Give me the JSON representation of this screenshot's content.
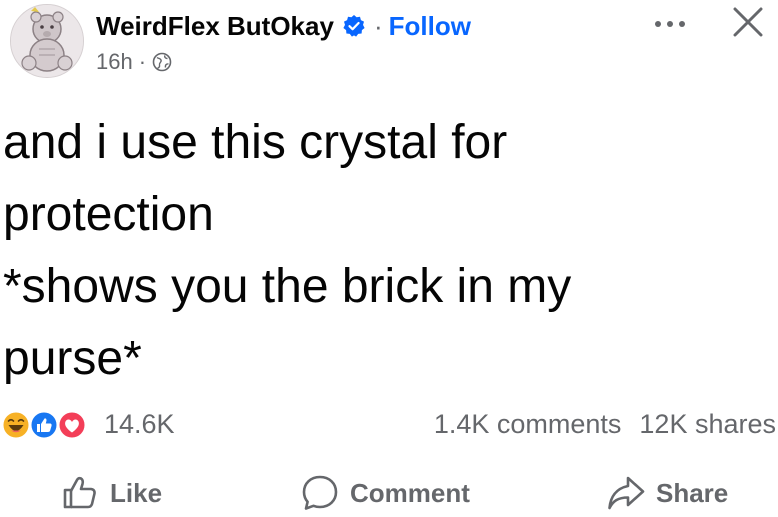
{
  "post": {
    "author": "WeirdFlex ButOkay",
    "separator": "·",
    "follow_label": "Follow",
    "time": "16h",
    "meta_dot": "·",
    "text": "and i use this crystal for\nprotection\n*shows you the brick in my\npurse*"
  },
  "stats": {
    "reactions_count": "14.6K",
    "comments": "1.4K comments",
    "shares": "12K shares",
    "reaction_icons": [
      "haha-icon",
      "like-icon",
      "love-icon"
    ]
  },
  "actions": {
    "like_label": "Like",
    "comment_label": "Comment",
    "share_label": "Share"
  },
  "colors": {
    "accent": "#0866ff",
    "text": "#050505",
    "muted": "#65676b",
    "like_blue": "#1877f2",
    "love_red": "#f33e58",
    "haha_yellow": "#f7b125"
  }
}
